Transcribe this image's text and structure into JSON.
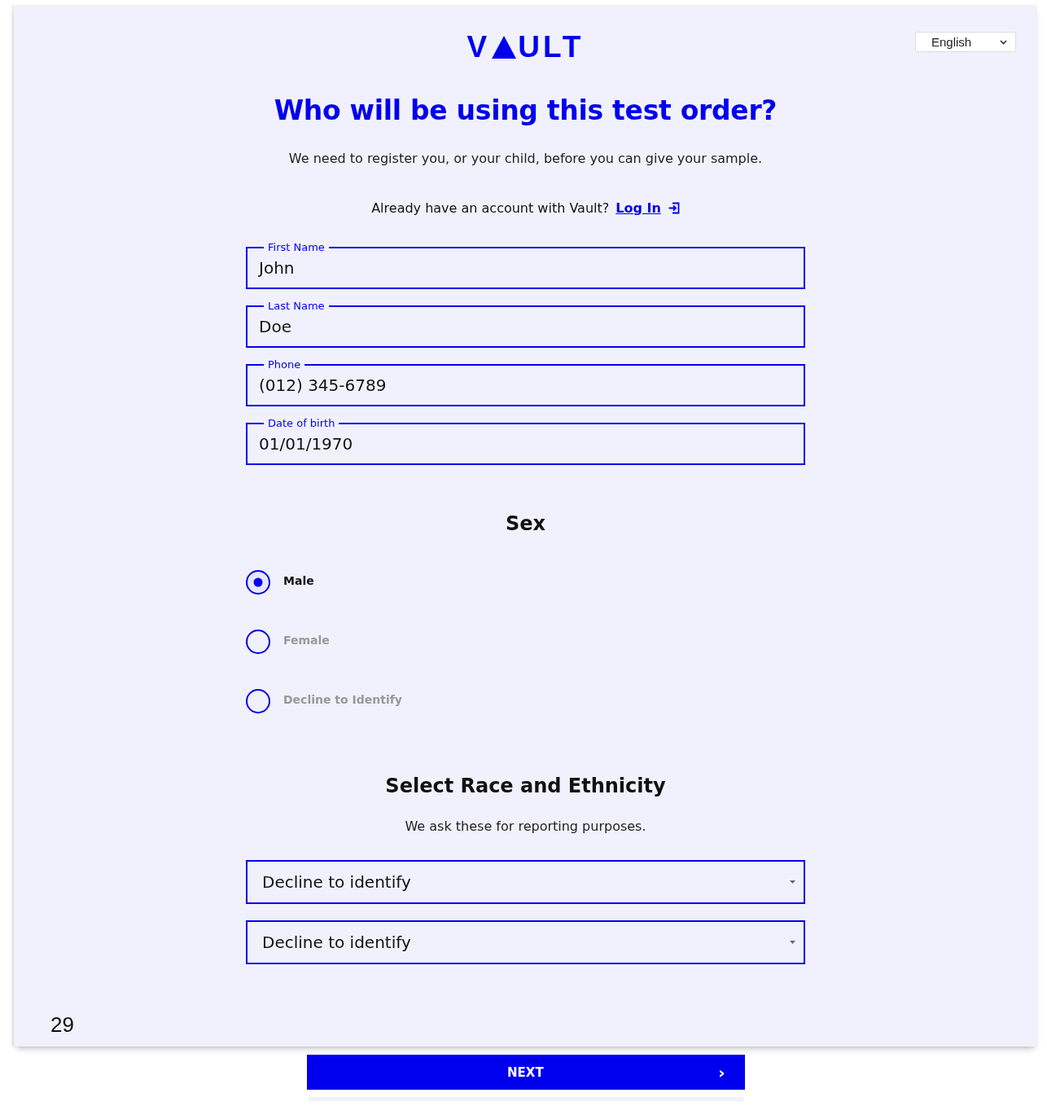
{
  "logo": {
    "before": "V",
    "after": "ULT"
  },
  "language": {
    "value": "English"
  },
  "title": "Who will be using this test order?",
  "subtitle": "We need to register you, or your child, before you can give your sample.",
  "account": {
    "text": "Already have an account with Vault?",
    "link": "Log In"
  },
  "fields": [
    {
      "label": "First Name",
      "value": "John"
    },
    {
      "label": "Last Name",
      "value": "Doe"
    },
    {
      "label": "Phone",
      "value": "(012) 345-6789"
    },
    {
      "label": "Date of birth",
      "value": "01/01/1970"
    }
  ],
  "sex": {
    "heading": "Sex",
    "options": [
      {
        "label": "Male",
        "selected": true
      },
      {
        "label": "Female",
        "selected": false
      },
      {
        "label": "Decline to Identify",
        "selected": false
      }
    ]
  },
  "race": {
    "heading": "Select Race and Ethnicity",
    "note": "We ask these for reporting purposes.",
    "selects": [
      {
        "value": "Decline to identify"
      },
      {
        "value": "Decline to identify"
      }
    ]
  },
  "page_number": "29",
  "next_button": {
    "label": "NEXT",
    "arrow": "›"
  }
}
